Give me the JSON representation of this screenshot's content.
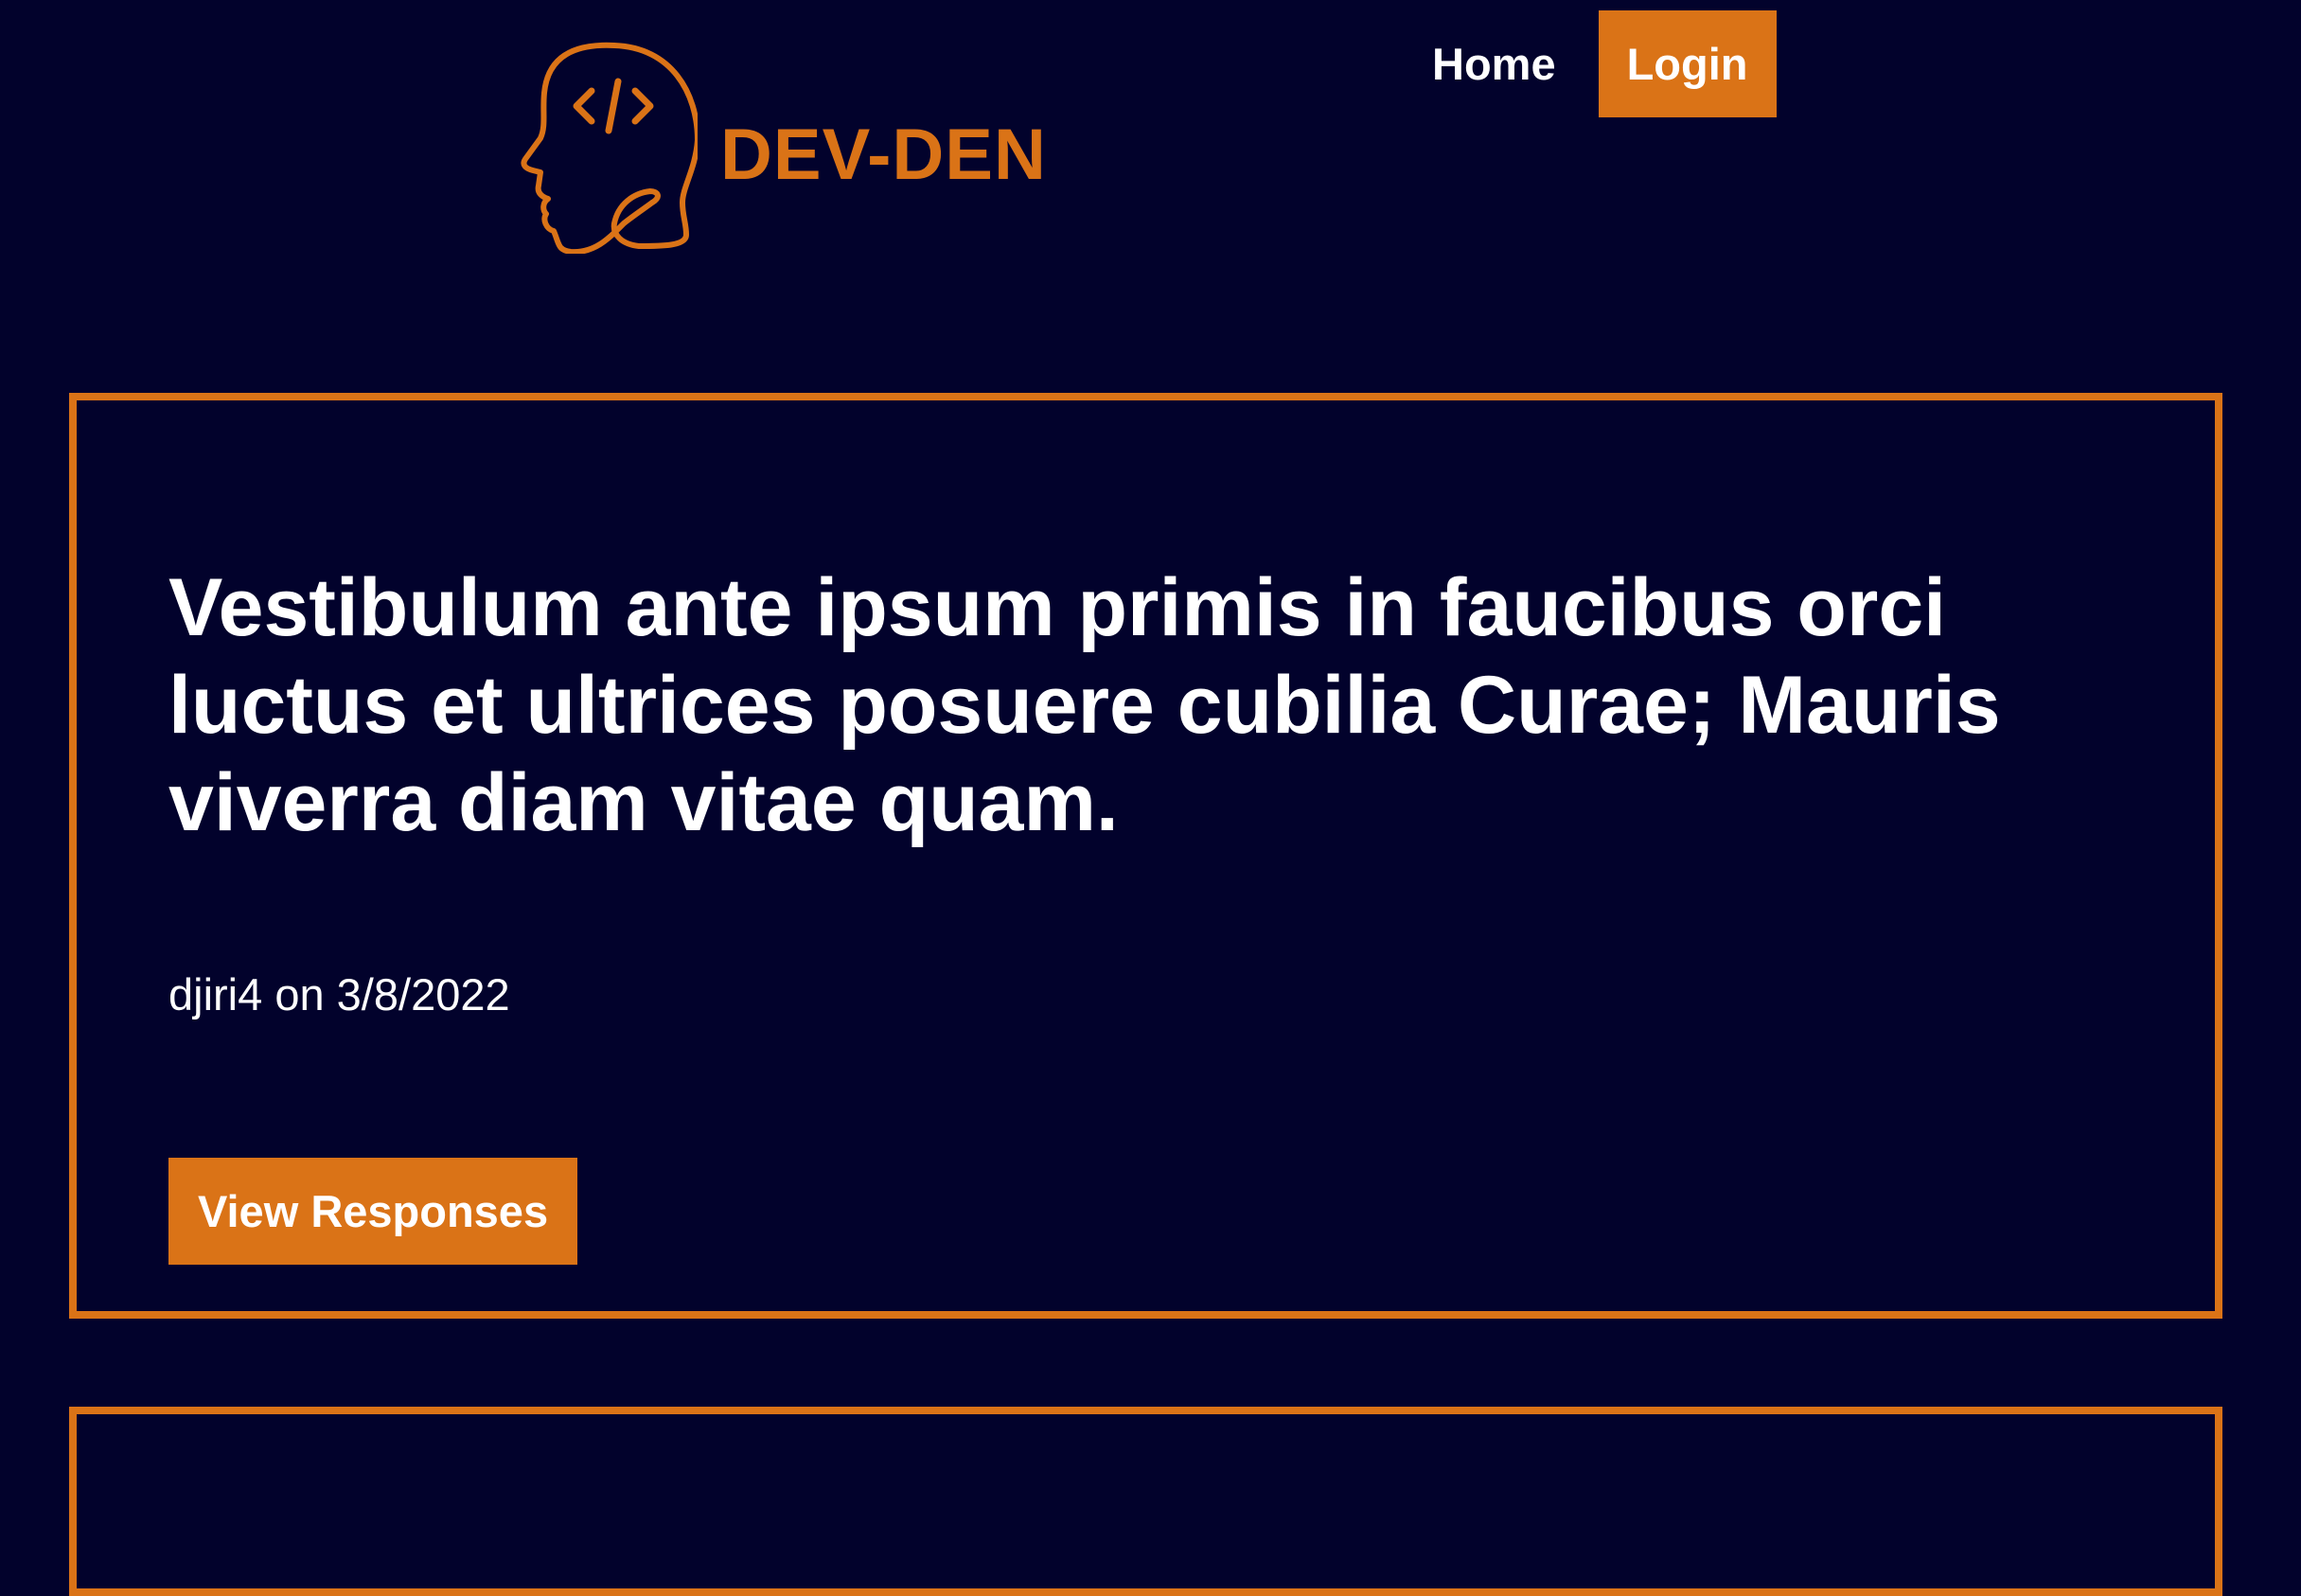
{
  "header": {
    "logo_text": "DEV-DEN",
    "logo_icon": "head-code-icon",
    "nav": {
      "home_label": "Home",
      "login_label": "Login"
    }
  },
  "posts": [
    {
      "title": "Vestibulum ante ipsum primis in faucibus orci luctus et ultrices posuere cubilia Curae; Mauris viverra diam vitae quam.",
      "author": "djiri4",
      "on_word": "on",
      "date": "3/8/2022",
      "button_label": "View Responses"
    }
  ],
  "colors": {
    "background": "#02022c",
    "accent": "#da7317",
    "text": "#ffffff"
  }
}
